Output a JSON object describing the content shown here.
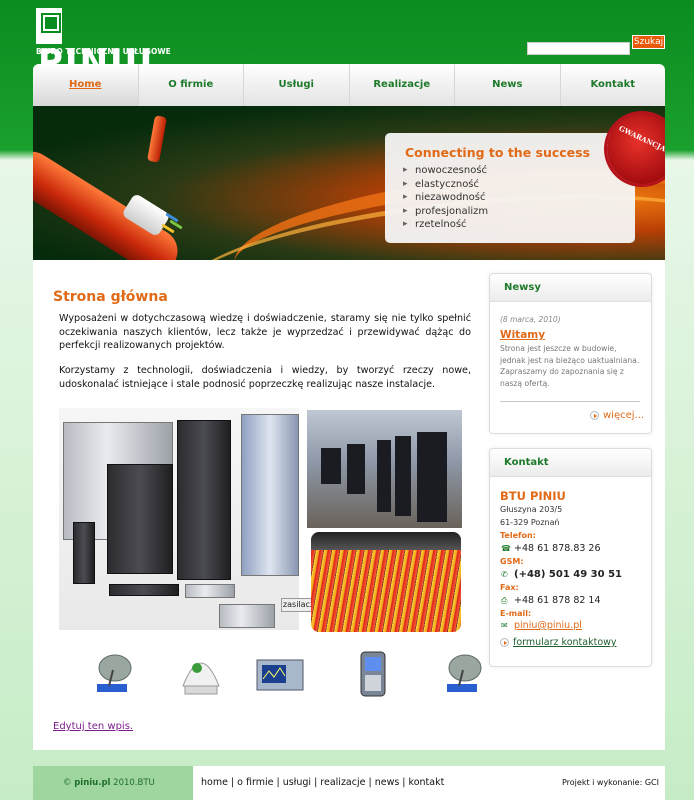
{
  "header": {
    "logo_text": "PINIU",
    "logo_subtitle": "BIURO TECHNICZNO USŁUGOWE",
    "search": {
      "placeholder": "",
      "button_label": "Szukaj"
    }
  },
  "nav": {
    "items": [
      {
        "label": "Home"
      },
      {
        "label": "O firmie"
      },
      {
        "label": "Usługi"
      },
      {
        "label": "Realizacje"
      },
      {
        "label": "News"
      },
      {
        "label": "Kontakt"
      }
    ],
    "active": "Home"
  },
  "banner": {
    "headline": "Connecting to the success",
    "items": [
      "nowoczesność",
      "elastyczność",
      "niezawodność",
      "profesjonalizm",
      "rzetelność"
    ],
    "seal_text": "GWARANCJA"
  },
  "main": {
    "title": "Strona główna",
    "paragraph1": "Wyposażeni w dotychczasową wiedzę i doświadczenie, staramy się nie tylko spełnić oczekiwania naszych klientów, lecz także je wyprzedzać i przewidywać dążąc do perfekcji realizowanych projektów.",
    "paragraph2": "Korzystamy z technologii, doświadczenia i wiedzy, by tworzyć rzeczy nowe, udoskonalać istniejące i stale podnosić poprzeczkę realizując nasze instalacje.",
    "photo_caption": "zasilacze",
    "edit_link": "Edytuj ten wpis."
  },
  "news": {
    "heading": "Newsy",
    "date": "(8 marca, 2010)",
    "title": "Witamy",
    "text": "Strona jest jeszcze w budowie, jednak jest na bieżąco uaktualniana. Zapraszamy do zapoznania się z naszą ofertą.",
    "more_label": "więcej..."
  },
  "contact": {
    "heading": "Kontakt",
    "company": "BTU PINIU",
    "street": "Głuszyna 203/5",
    "city": "61-329 Poznań",
    "phone_label": "Telefon:",
    "phone": "+48 61 878.83 26",
    "gsm_label": "GSM:",
    "gsm": "(+48) 501 49 30 51",
    "fax_label": "Fax:",
    "fax": "+48 61 878 82 14",
    "email_label": "E-mail:",
    "email": "piniu@piniu.pl",
    "form_link": "formularz kontaktowy"
  },
  "footer": {
    "copyright_prefix": "©",
    "site": "piniu.pl",
    "year_text": "2010.BTU",
    "links": "home | o firmie | usługi | realizacje | news | kontakt",
    "credit": "Projekt i wykonanie: GCI"
  },
  "colors": {
    "brand_green": "#0b8c1f",
    "accent_orange": "#e06a17",
    "link_green": "#1e7a2a"
  }
}
